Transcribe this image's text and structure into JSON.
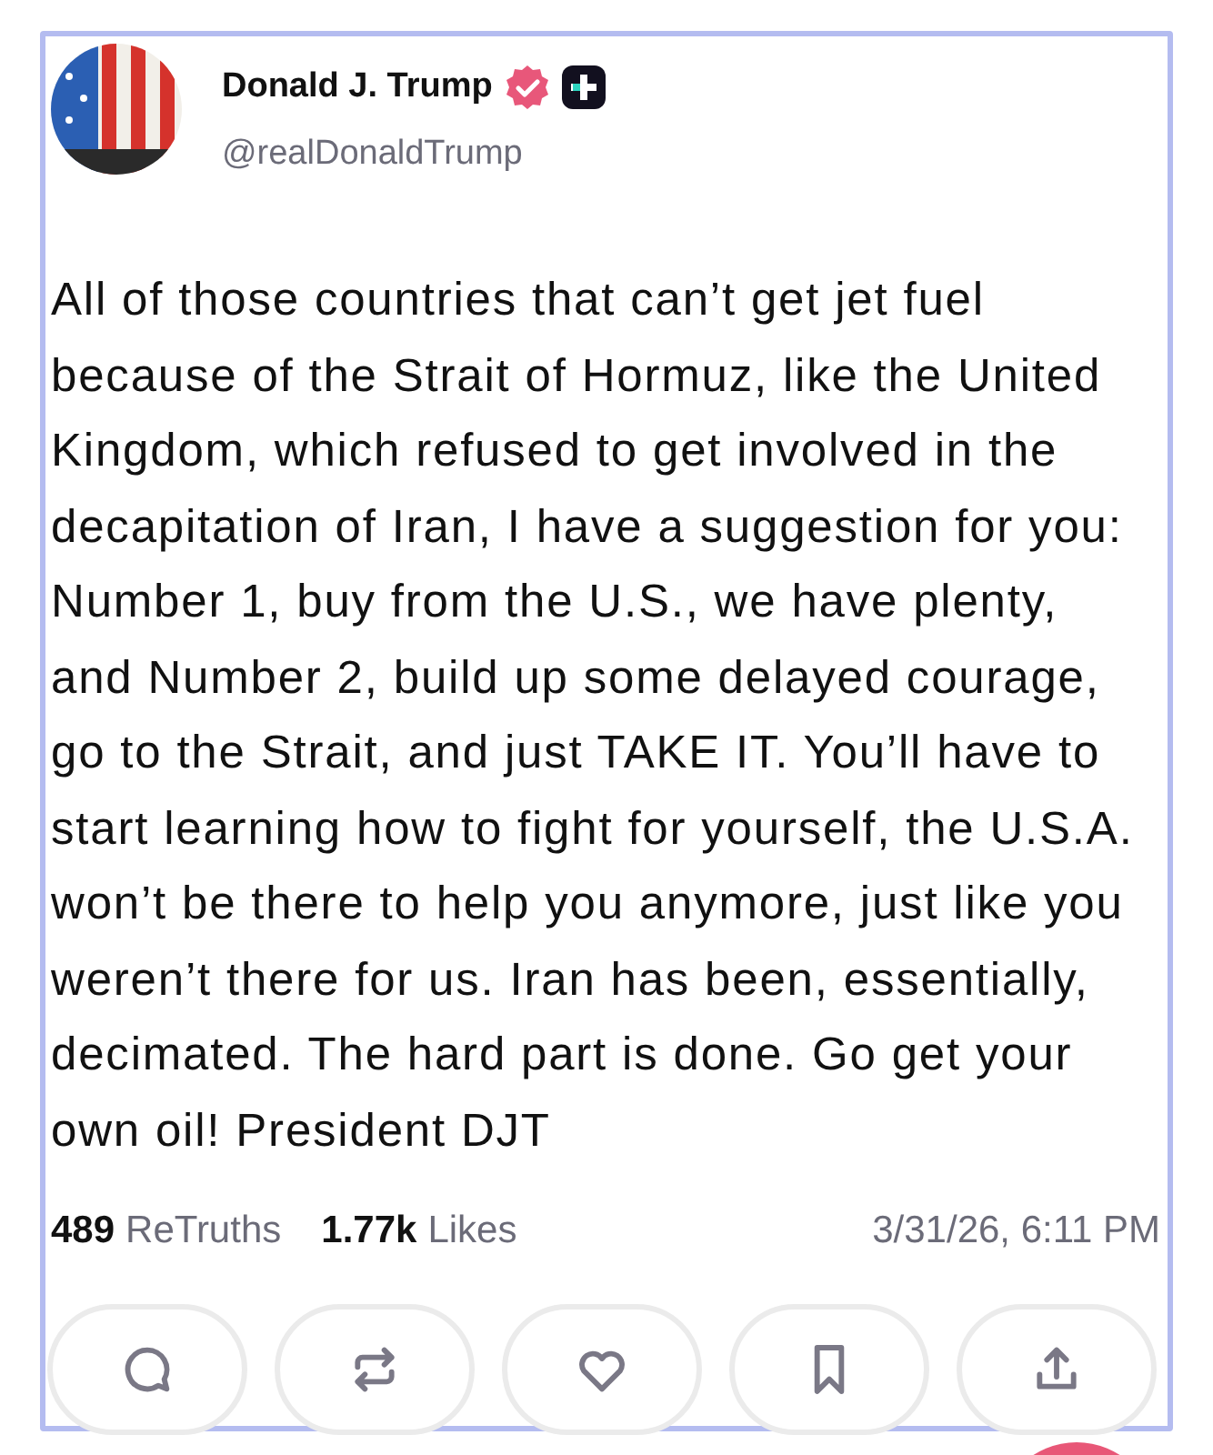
{
  "post": {
    "author": {
      "name": "Donald J. Trump",
      "verified": true,
      "handle": "@realDonaldTrump"
    },
    "text": "All of those countries that can’t get jet fuel because of the Strait of Hormuz, like the United Kingdom, which refused to get involved in the decapitation of Iran, I have a suggestion for you: Number 1, buy from the U.S., we have plenty, and Number 2, build up some delayed courage, go to the Strait, and just TAKE IT. You’ll have to start learning how to fight for yourself, the U.S.A. won’t be there to help you anymore, just like you weren’t there for us. Iran has been, essentially, decimated. The hard part is done. Go get your own oil! President DJT",
    "stats": [
      {
        "count": "489",
        "label": "ReTruths"
      },
      {
        "count": "1.77k",
        "label": "Likes"
      }
    ],
    "timestamp": "3/31/26, 6:11 PM",
    "actions": [
      {
        "kind": "reply"
      },
      {
        "kind": "repost"
      },
      {
        "kind": "like"
      },
      {
        "kind": "bookmark"
      },
      {
        "kind": "share"
      }
    ]
  }
}
